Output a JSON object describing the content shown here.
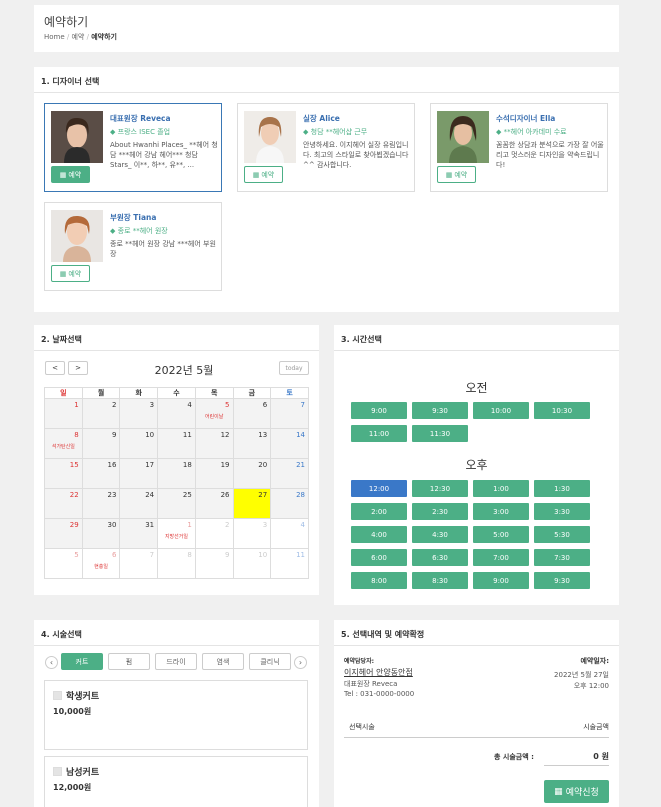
{
  "header": {
    "title": "예약하기",
    "breadcrumb": [
      "Home",
      "예약",
      "예약하기"
    ]
  },
  "designer_section": {
    "title": "1. 디자이너 선택",
    "book_label": "예약",
    "designers": [
      {
        "name": "대표원장 Reveca",
        "title": "프랑스 ISEC 졸업",
        "desc": "About Hwanhi Places_ **헤어 청담 ***헤어 강남 헤어*** 청담 Stars_ 이**, 하**, 유**, ...",
        "selected": true
      },
      {
        "name": "실장 Alice",
        "title": "청담 **헤어샵 근무",
        "desc": "안녕하세요. 이지헤어 실장 유림입니다. 최고의 스타일로 찾아뵙겠습니다 ^^ 감사합니다.",
        "selected": false
      },
      {
        "name": "수석디자이너 Ella",
        "title": "**헤어 아카데미 수료",
        "desc": "꼼꼼한 상담과 분석으로 가장 잘 어울리고 멋스러운 디자인을 약속드립니다!",
        "selected": false
      },
      {
        "name": "부원장 Tiana",
        "title": "종로 **헤어 원장",
        "desc": "종로 **헤어 원장 강남 ***헤어 부원장",
        "selected": false
      }
    ]
  },
  "date_section": {
    "title": "2. 날짜선택",
    "month_label": "2022년 5월",
    "today_label": "today",
    "prev": "<",
    "next": ">",
    "weekdays": [
      "일",
      "월",
      "화",
      "수",
      "목",
      "금",
      "토"
    ],
    "weeks": [
      [
        {
          "d": "1"
        },
        {
          "d": "2"
        },
        {
          "d": "3"
        },
        {
          "d": "4"
        },
        {
          "d": "5",
          "ev": "어린이날"
        },
        {
          "d": "6"
        },
        {
          "d": "7"
        }
      ],
      [
        {
          "d": "8",
          "ev": "석가탄신일"
        },
        {
          "d": "9"
        },
        {
          "d": "10"
        },
        {
          "d": "11"
        },
        {
          "d": "12"
        },
        {
          "d": "13"
        },
        {
          "d": "14"
        }
      ],
      [
        {
          "d": "15"
        },
        {
          "d": "16"
        },
        {
          "d": "17"
        },
        {
          "d": "18"
        },
        {
          "d": "19"
        },
        {
          "d": "20"
        },
        {
          "d": "21"
        }
      ],
      [
        {
          "d": "22"
        },
        {
          "d": "23"
        },
        {
          "d": "24"
        },
        {
          "d": "25"
        },
        {
          "d": "26"
        },
        {
          "d": "27",
          "today": true
        },
        {
          "d": "28"
        }
      ],
      [
        {
          "d": "29"
        },
        {
          "d": "30"
        },
        {
          "d": "31"
        },
        {
          "d": "1",
          "m": true,
          "ev": "지방선거일"
        },
        {
          "d": "2",
          "m": true
        },
        {
          "d": "3",
          "m": true
        },
        {
          "d": "4",
          "m": true
        }
      ],
      [
        {
          "d": "5",
          "m": true
        },
        {
          "d": "6",
          "m": true,
          "ev": "현충일"
        },
        {
          "d": "7",
          "m": true
        },
        {
          "d": "8",
          "m": true
        },
        {
          "d": "9",
          "m": true
        },
        {
          "d": "10",
          "m": true
        },
        {
          "d": "11",
          "m": true
        }
      ]
    ]
  },
  "time_section": {
    "title": "3. 시간선택",
    "am_label": "오전",
    "pm_label": "오후",
    "am_slots": [
      "9:00",
      "9:30",
      "10:00",
      "10:30",
      "11:00",
      "11:30"
    ],
    "pm_slots": [
      "12:00",
      "12:30",
      "1:00",
      "1:30",
      "2:00",
      "2:30",
      "3:00",
      "3:30",
      "4:00",
      "4:30",
      "5:00",
      "5:30",
      "6:00",
      "6:30",
      "7:00",
      "7:30",
      "8:00",
      "8:30",
      "9:00",
      "9:30"
    ],
    "selected": "12:00"
  },
  "service_section": {
    "title": "4. 시술선택",
    "prev": "‹",
    "next": "›",
    "tabs": [
      "커트",
      "펌",
      "드라이",
      "염색",
      "클리닉"
    ],
    "active_tab": "커트",
    "items": [
      {
        "name": "학생커트",
        "price": "10,000원"
      },
      {
        "name": "남성커트",
        "price": "12,000원"
      }
    ]
  },
  "confirm_section": {
    "title": "5. 선택내역 및 예약확정",
    "shop_label": "예약담당자:",
    "shop_name": "이지헤어 안양동안점",
    "designer": "대표원장 Reveca",
    "tel": "Tel : 031-0000-0000",
    "date_label": "예약일자:",
    "date": "2022년 5월 27일",
    "time": "오후 12:00",
    "col_service": "선택시술",
    "col_price": "시술금액",
    "total_label": "총 시술금액 :",
    "total_value": "0 원",
    "submit_label": "예약신청"
  },
  "colors": {
    "accent": "#4caf86",
    "selected_blue": "#3a78c8",
    "today_yellow": "#ffff00",
    "sunday_red": "#d33333"
  }
}
